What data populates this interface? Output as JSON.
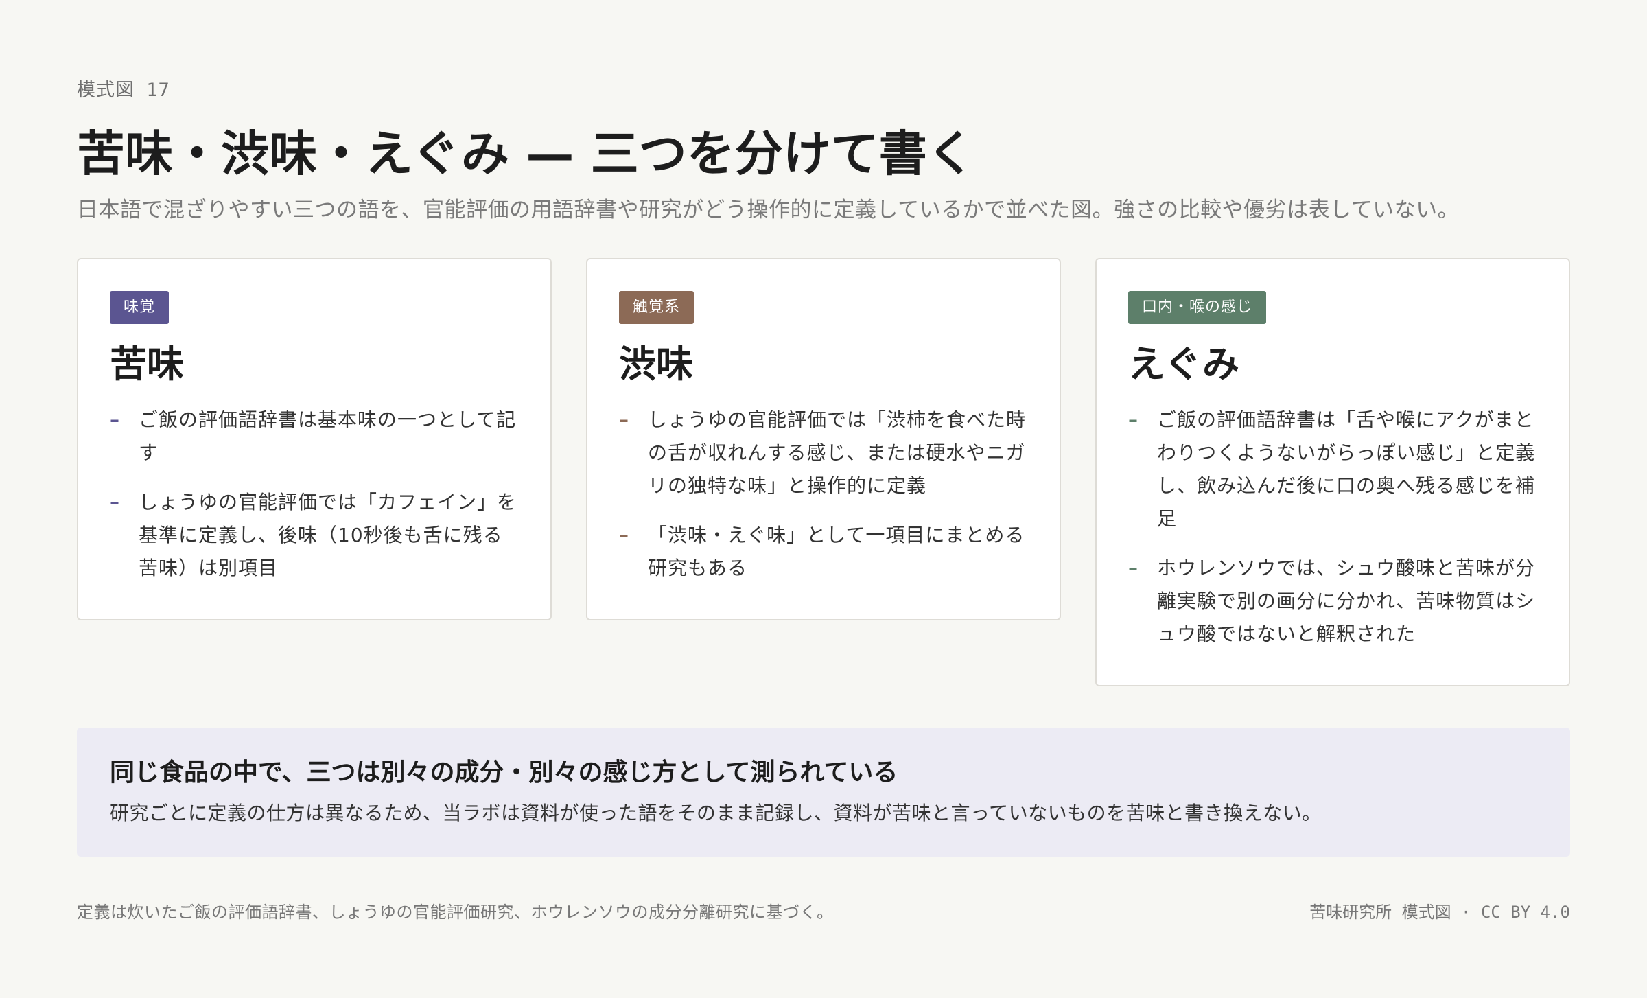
{
  "header": {
    "eyebrow": "模式図 17",
    "title": "苦味・渋味・えぐみ — 三つを分けて書く",
    "subtitle": "日本語で混ざりやすい三つの語を、官能評価の用語辞書や研究がどう操作的に定義しているかで並べた図。強さの比較や優劣は表していない。"
  },
  "cards": [
    {
      "badge": "味覚",
      "badge_color": "#5b5591",
      "dash_color": "#5b5591",
      "term": "苦味",
      "points": [
        "ご飯の評価語辞書は基本味の一つとして記す",
        "しょうゆの官能評価では「カフェイン」を基準に定義し、後味（10秒後も舌に残る苦味）は別項目"
      ]
    },
    {
      "badge": "触覚系",
      "badge_color": "#8c6a56",
      "dash_color": "#8c6a56",
      "term": "渋味",
      "points": [
        "しょうゆの官能評価では「渋柿を食べた時の舌が収れんする感じ、または硬水やニガリの独特な味」と操作的に定義",
        "「渋味・えぐ味」として一項目にまとめる研究もある"
      ]
    },
    {
      "badge": "口内・喉の感じ",
      "badge_color": "#5d7f6a",
      "dash_color": "#5d7f6a",
      "term": "えぐみ",
      "points": [
        "ご飯の評価語辞書は「舌や喉にアクがまとわりつくようないがらっぽい感じ」と定義し、飲み込んだ後に口の奥へ残る感じを補足",
        "ホウレンソウでは、シュウ酸味と苦味が分離実験で別の画分に分かれ、苦味物質はシュウ酸ではないと解釈された"
      ]
    }
  ],
  "summary": {
    "heading": "同じ食品の中で、三つは別々の成分・別々の感じ方として測られている",
    "body": "研究ごとに定義の仕方は異なるため、当ラボは資料が使った語をそのまま記録し、資料が苦味と言っていないものを苦味と書き換えない。"
  },
  "footer": {
    "note": "定義は炊いたご飯の評価語辞書、しょうゆの官能評価研究、ホウレンソウの成分分離研究に基づく。",
    "credit": "苦味研究所 模式図 · CC BY 4.0"
  },
  "dash_glyph": "–"
}
